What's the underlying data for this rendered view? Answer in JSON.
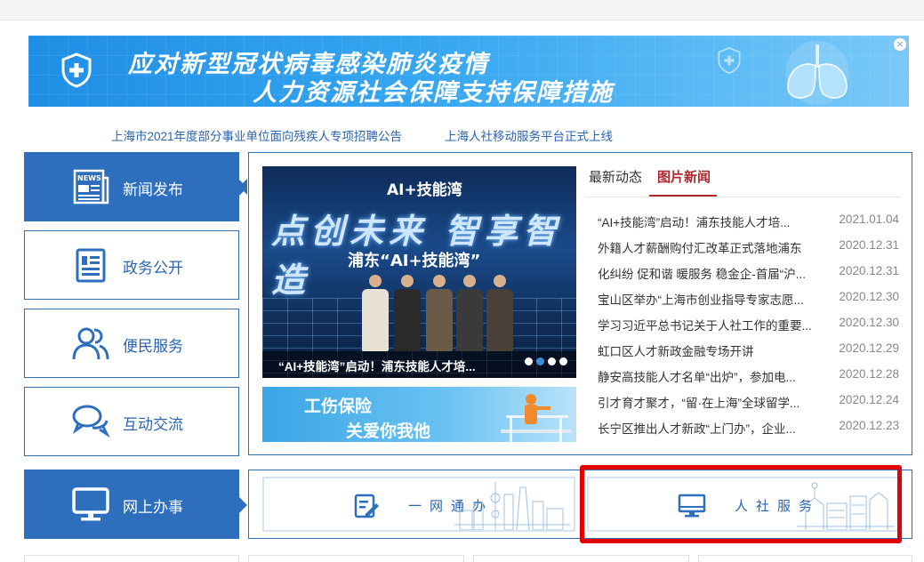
{
  "banner": {
    "line1": "应对新型冠状病毒感染肺炎疫情",
    "line2": "人力资源社会保障支持保障措施",
    "close": "×"
  },
  "notices": [
    "上海市2021年度部分事业单位面向残疾人专项招聘公告",
    "上海人社移动服务平台正式上线"
  ],
  "nav": {
    "news": "新闻发布",
    "gov": "政务公开",
    "service": "便民服务",
    "interact": "互动交流",
    "online": "网上办事"
  },
  "carousel": {
    "brand": "AI+技能湾",
    "headline": "点创未来 智享智造",
    "subtitle": "浦东“AI+技能湾”",
    "caption": "“AI+技能湾”启动！浦东技能人才培...",
    "slide_count": 4,
    "active_slide": 2
  },
  "injury_banner": {
    "line1": "工伤保险",
    "line2": "关爱你我他"
  },
  "tabs": {
    "latest": "最新动态",
    "pictures": "图片新闻",
    "active": "pictures"
  },
  "news": [
    {
      "title": "“AI+技能湾”启动！浦东技能人才培...",
      "date": "2021.01.04"
    },
    {
      "title": "外籍人才薪酬购付汇改革正式落地浦东",
      "date": "2020.12.31"
    },
    {
      "title": "化纠纷 促和谐 暖服务 稳金企-首届“沪...",
      "date": "2020.12.31"
    },
    {
      "title": "宝山区举办“上海市创业指导专家志愿...",
      "date": "2020.12.30"
    },
    {
      "title": "学习习近平总书记关于人社工作的重要...",
      "date": "2020.12.30"
    },
    {
      "title": "虹口区人才新政金融专场开讲",
      "date": "2020.12.29"
    },
    {
      "title": "静安高技能人才名单“出炉”，参加电...",
      "date": "2020.12.28"
    },
    {
      "title": "引才育才聚才，“留·在上海”全球留学...",
      "date": "2020.12.24"
    },
    {
      "title": "长宁区推出人才新政“上门办”，企业...",
      "date": "2020.12.23"
    }
  ],
  "services": {
    "one_network": "一网通办",
    "hr_service": "人社服务"
  },
  "colors": {
    "brand_blue": "#2e6fbd",
    "link_blue": "#2b64ad",
    "accent_red": "#b0282d",
    "highlight_red": "#e30000"
  }
}
